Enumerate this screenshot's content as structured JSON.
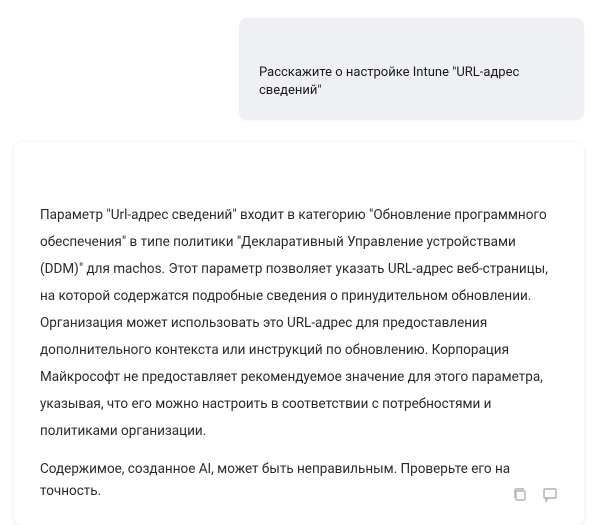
{
  "user": {
    "prompt": "Расскажите о настройке Intune \"URL-адрес сведений\""
  },
  "assistant": {
    "body": "Параметр \"Url-адрес сведений\" входит в категорию \"Обновление программного обеспечения\" в типе политики \"Декларативный Управление устройствами (DDM)\" для machos. Этот параметр позволяет указать URL-адрес веб-страницы, на которой содержатся подробные сведения о принудительном обновлении. Организация может использовать это URL-адрес для предоставления дополнительного контекста или инструкций по обновлению. Корпорация Майкрософт не предоставляет рекомендуемое значение для этого параметра, указывая, что его можно настроить в соответствии с потребностями и политиками организации.",
    "disclaimer": "Содержимое, созданное AI, может быть неправильным. Проверьте его на точность."
  },
  "icons": {
    "copy": "copy-icon",
    "feedback": "feedback-icon"
  }
}
